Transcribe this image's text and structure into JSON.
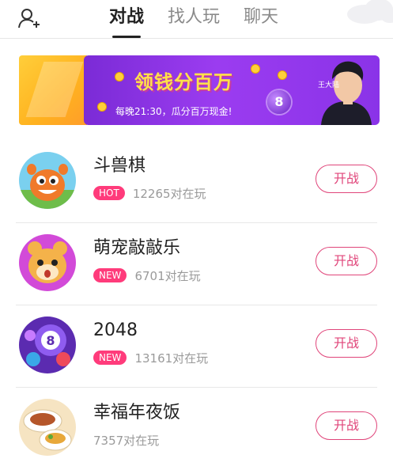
{
  "header": {
    "tabs": [
      {
        "label": "对战",
        "active": true
      },
      {
        "label": "找人玩",
        "active": false
      },
      {
        "label": "聊天",
        "active": false
      }
    ]
  },
  "banner": {
    "title": "领钱分百万",
    "subtitle": "每晚21:30，瓜分百万现金!",
    "ball_number": "8",
    "host_name": "王大陆"
  },
  "games": [
    {
      "title": "斗兽棋",
      "badge": "HOT",
      "count": "12265对在玩",
      "button": "开战"
    },
    {
      "title": "萌宠敲敲乐",
      "badge": "NEW",
      "count": "6701对在玩",
      "button": "开战"
    },
    {
      "title": "2048",
      "badge": "NEW",
      "count": "13161对在玩",
      "button": "开战"
    },
    {
      "title": "幸福年夜饭",
      "badge": "",
      "count": "7357对在玩",
      "button": "开战"
    }
  ],
  "colors": {
    "accent": "#e0457a",
    "badge": "#ff3b7b",
    "banner_purple": "#8a33e8"
  },
  "icons": [
    "add-user-icon",
    "cloud-icon"
  ]
}
